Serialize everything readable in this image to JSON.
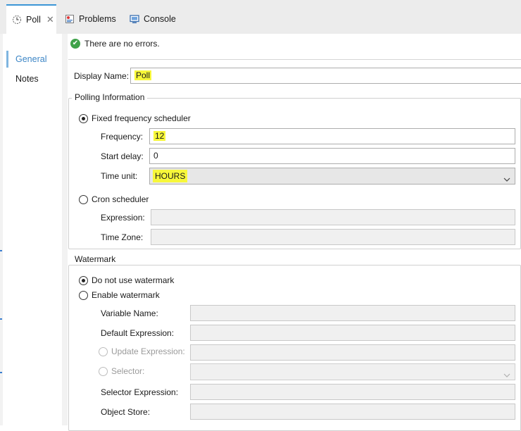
{
  "tabs": [
    {
      "label": "Poll",
      "icon": "clock-icon",
      "active": true
    },
    {
      "label": "Problems",
      "icon": "problems-icon"
    },
    {
      "label": "Console",
      "icon": "console-icon"
    }
  ],
  "nav": [
    {
      "label": "General",
      "active": true
    },
    {
      "label": "Notes"
    }
  ],
  "status": {
    "text": "There are no errors.",
    "icon": "check-circle-icon"
  },
  "display_name": {
    "label": "Display Name:",
    "value": "Poll"
  },
  "polling": {
    "legend": "Polling Information",
    "fixed": {
      "label": "Fixed frequency scheduler",
      "selected": true,
      "frequency_label": "Frequency:",
      "frequency_value": "12",
      "start_delay_label": "Start delay:",
      "start_delay_value": "0",
      "time_unit_label": "Time unit:",
      "time_unit_value": "HOURS"
    },
    "cron": {
      "label": "Cron scheduler",
      "selected": false,
      "expression_label": "Expression:",
      "timezone_label": "Time Zone:"
    }
  },
  "watermark": {
    "legend": "Watermark",
    "no_watermark_label": "Do not use watermark",
    "enable_label": "Enable watermark",
    "variable_name_label": "Variable Name:",
    "default_expression_label": "Default Expression:",
    "update_expression_label": "Update Expression:",
    "selector_label": "Selector:",
    "selector_expression_label": "Selector Expression:",
    "object_store_label": "Object Store:"
  },
  "colors": {
    "accent": "#3c96d6",
    "highlight": "#f7f73a",
    "ok": "#3fa24a"
  }
}
